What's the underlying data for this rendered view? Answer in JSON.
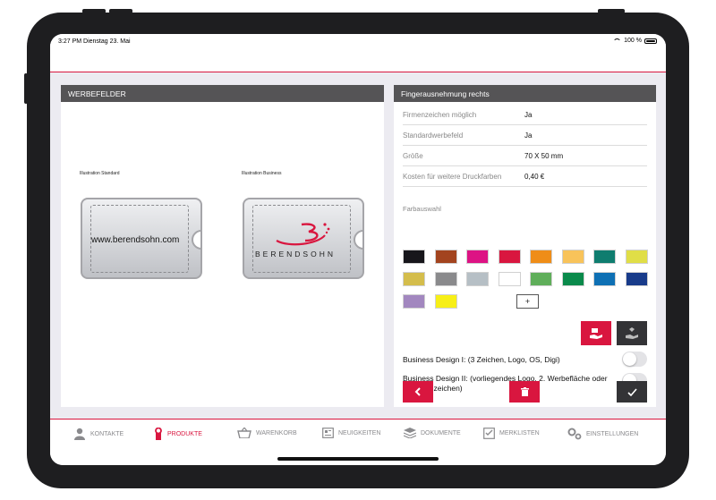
{
  "status": {
    "time": "3:27 PM  Dienstag 23. Mai",
    "battery": "100 %"
  },
  "left_panel": {
    "title": "WERBEFELDER",
    "illus_standard": "Illustration Standard",
    "illus_business": "Illustration Business",
    "card_url": "www.berendsohn.com",
    "card_logo_text": "BERENDSOHN"
  },
  "right_panel": {
    "title": "Fingerausnehmung rechts",
    "rows": [
      {
        "label": "Firmenzeichen möglich",
        "value": "Ja"
      },
      {
        "label": "Standardwerbefeld",
        "value": "Ja"
      },
      {
        "label": "Größe",
        "value": "70 X 50 mm"
      },
      {
        "label": "Kosten für weitere Druckfarben",
        "value": "0,40 €"
      }
    ],
    "farbauswahl_label": "Farbauswahl",
    "swatches": [
      "#17161b",
      "#a3441f",
      "#dd1384",
      "#d9163f",
      "#ef8d18",
      "#f8c35a",
      "#0f7d6f",
      "#e0de47",
      "#d4bd4c",
      "#8a8a8c",
      "#b6bfc5",
      "#ffffff",
      "#5fae5a",
      "#0a8a4b",
      "#0e70b4",
      "#183b8a",
      "#a287bf",
      "#f7ef17"
    ],
    "add_swatch_label": "+",
    "toggles": [
      {
        "label": "Business Design I: (3 Zeichen, Logo, OS, Digi)",
        "on": false
      },
      {
        "label": "Business Design II: (vorliegendes Logo, 2. Werbefläche oder Standardzeichen)",
        "on": false
      }
    ]
  },
  "tabs": [
    {
      "label": "KONTAKTE",
      "icon": "person-icon",
      "active": false
    },
    {
      "label": "PRODUKTE",
      "icon": "key-icon",
      "active": true
    },
    {
      "label": "WARENKORB",
      "icon": "basket-icon",
      "active": false
    },
    {
      "label": "NEUIGKEITEN",
      "icon": "newspaper-icon",
      "active": false
    },
    {
      "label": "DOKUMENTE",
      "icon": "stack-icon",
      "active": false
    },
    {
      "label": "MERKLISTEN",
      "icon": "checklist-icon",
      "active": false
    },
    {
      "label": "EINSTELLUNGEN",
      "icon": "gears-icon",
      "active": false
    }
  ],
  "colors": {
    "accent": "#d9163f",
    "header": "#555456",
    "dark_button": "#333336"
  }
}
